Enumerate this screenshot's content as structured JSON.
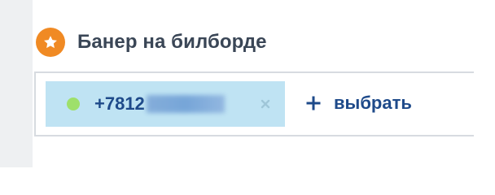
{
  "section": {
    "icon": "star-icon",
    "title": "Банер на билборде"
  },
  "field": {
    "chip": {
      "status_color": "#9ee06b",
      "phone_prefix": "+7812",
      "remove_icon": "close-icon"
    },
    "add_action": {
      "icon": "plus-icon",
      "label": "выбрать"
    }
  },
  "colors": {
    "accent_orange": "#f08a24",
    "chip_background": "#bfe3f3",
    "link_blue": "#1e4a8a",
    "title_gray": "#3a4656"
  }
}
